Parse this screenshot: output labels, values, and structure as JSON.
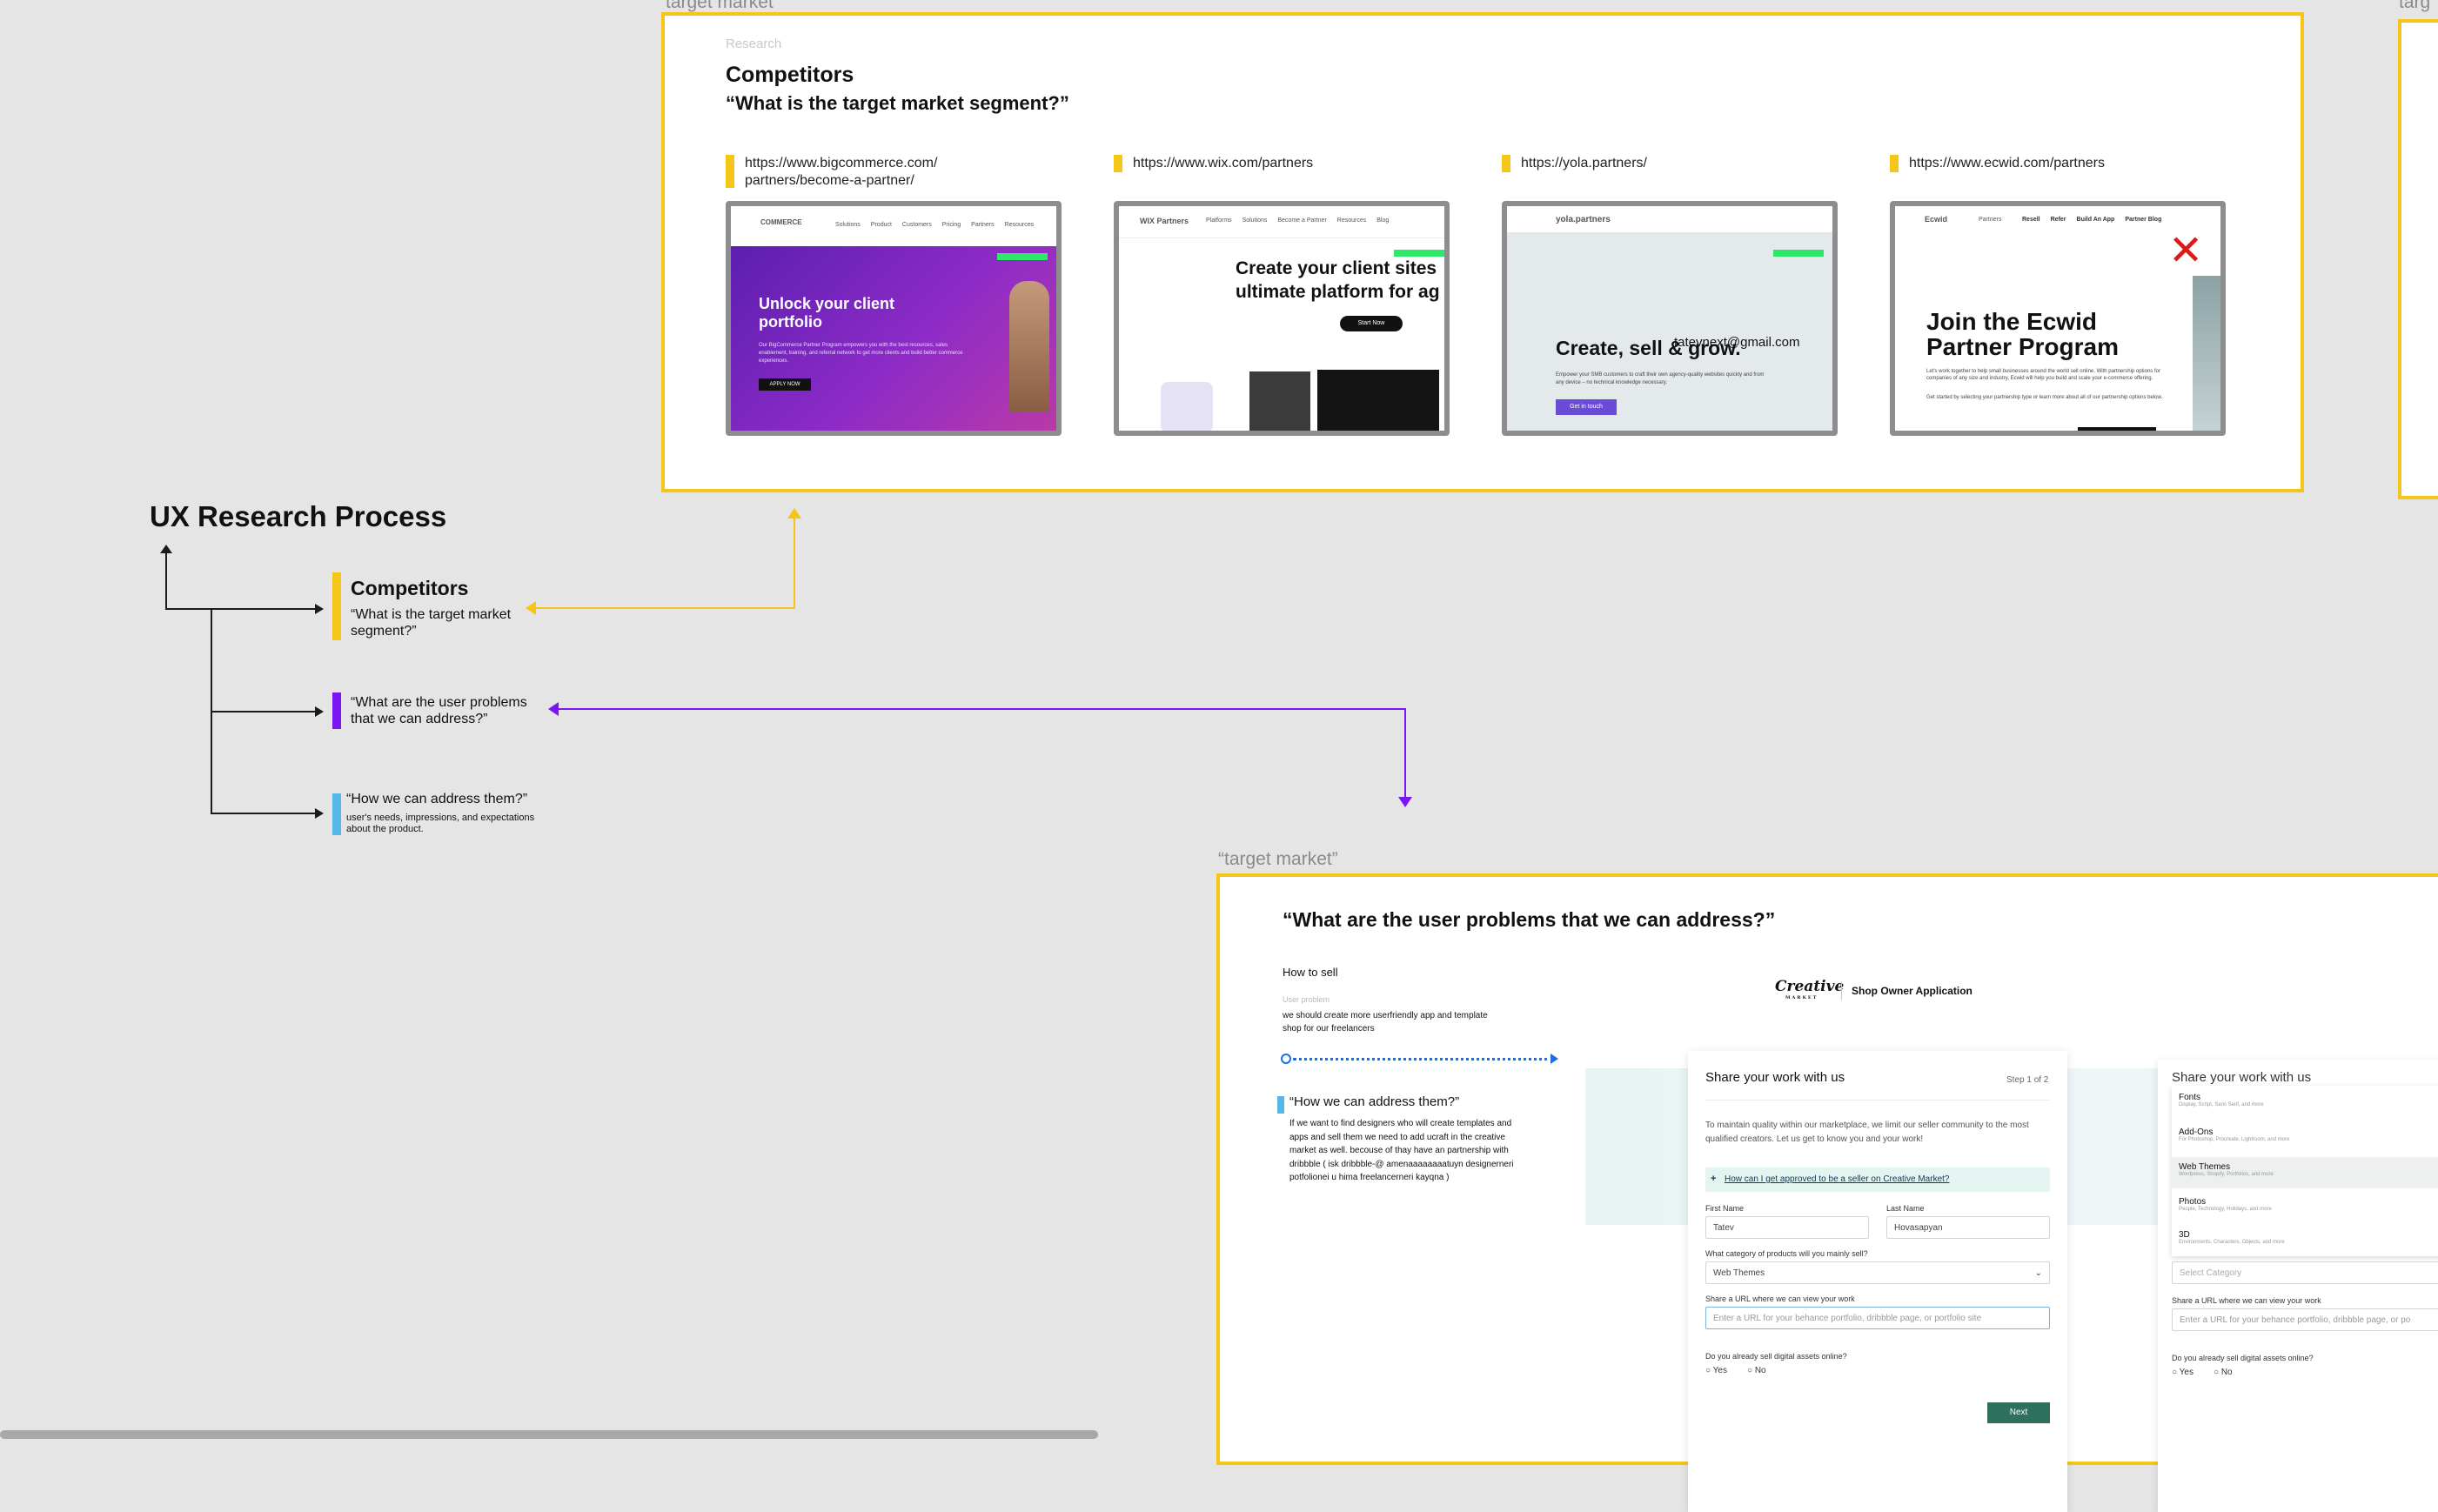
{
  "colors": {
    "accent_yellow": "#f5c518",
    "accent_purple": "#7a16f2",
    "accent_blue": "#54b8e8",
    "canvas": "#e5e5e5"
  },
  "top_frame": {
    "partial_label": "target market",
    "section": "Research",
    "title": "Competitors",
    "subtitle": "“What is the target market segment?”",
    "competitors": [
      {
        "url_line1": "https://www.bigcommerce.com/",
        "url_line2": "partners/become-a-partner/",
        "brand": "COMMERCE",
        "nav": [
          "Solutions",
          "Product",
          "Customers",
          "Pricing",
          "Partners",
          "Resources"
        ],
        "headline_1": "Unlock your client",
        "headline_2": "portfolio",
        "body": "Our BigCommerce Partner Program empowers you with the best resources, sales enablement, training, and referral network to get more clients and build better commerce experiences.",
        "cta": "APPLY NOW"
      },
      {
        "url_line1": "https://www.wix.com/partners",
        "brand": "WIX Partners",
        "nav": [
          "Platforms",
          "Solutions",
          "Become a Partner",
          "Resources",
          "Blog"
        ],
        "headline_1": "Create your client sites",
        "headline_2": "ultimate platform for ag",
        "cta": "Start Now"
      },
      {
        "url_line1": "https://yola.partners/",
        "brand": "yola.partners",
        "headline_1": "Create, sell & grow.",
        "overlay": "tatevnext@gmail.com",
        "body": "Empower your SMB customers to craft their own agency-quality websites quickly and from any device – no technical knowledge necessary.",
        "cta": "Get in touch"
      },
      {
        "url_line1": "https://www.ecwid.com/partners",
        "brand": "Ecwid",
        "brand_sub": "Partners",
        "nav": [
          "Resell",
          "Refer",
          "Build An App",
          "Partner Blog"
        ],
        "headline_1": "Join the Ecwid",
        "headline_2": "Partner Program",
        "body": "Let's work together to help small businesses around the world sell online. With partnership options for companies of any size and industry, Ecwid will help you build and scale your e-commerce offering.",
        "body2": "Get started by selecting your partnership type or learn more about all of our partnership options below.",
        "close_mark": "✕"
      }
    ]
  },
  "right_edge_label": "“targ",
  "process": {
    "title": "UX Research Process",
    "items": [
      {
        "title": "Competitors",
        "text": "“What is the target market segment?”"
      },
      {
        "text": "“What are the user problems that we can address?”"
      },
      {
        "text": "“How we can address them?”",
        "subtext": "user's needs, impressions, and expectations about the product."
      }
    ]
  },
  "bottom_frame": {
    "label": "“target market”",
    "title": "“What are the user problems that we can address?”",
    "how_to_sell": "How to sell",
    "user_problem_label": "User problem",
    "user_problem_text": "we should create more userfriendly app and template shop for our freelancers",
    "how_title": "“How we can address them?”",
    "how_text": "If we want to find designers who will create templates and apps and sell them we need to add ucraft in the creative market as well. becouse of thay have an partnership with dribbble ( isk dribbble-@ amenaaaaaaaatuyn designerneri potfolionei u hima freelancerneri kayqna )",
    "app": {
      "logo": "Creative",
      "logo_sub": "MARKET",
      "header": "Shop Owner Application",
      "card_title": "Share your work with us",
      "step": "Step 1 of 2",
      "intro": "To maintain quality within our marketplace, we limit our seller community to the most qualified creators. Let us get to know you and your work!",
      "faq": "How can I get approved to be a seller on Creative Market?",
      "first_name_label": "First Name",
      "first_name": "Tatev",
      "last_name_label": "Last Name",
      "last_name": "Hovasapyan",
      "category_label": "What category of products will you mainly sell?",
      "category": "Web Themes",
      "url_label": "Share a URL where we can view your work",
      "url_placeholder": "Enter a URL for your behance portfolio, dribbble page, or portfolio site",
      "digital_label": "Do you already sell digital assets online?",
      "yes": "Yes",
      "no": "No",
      "next": "Next"
    },
    "dropdown": {
      "card_title": "Share your work with us",
      "items": [
        {
          "name": "Fonts",
          "desc": "Display, Script, Sans Serif, and more"
        },
        {
          "name": "Add-Ons",
          "desc": "For Photoshop, Procreate, Lightroom, and more"
        },
        {
          "name": "Web Themes",
          "desc": "Wordpress, Shopify, Portfolios, and more"
        },
        {
          "name": "Photos",
          "desc": "People, Technology, Holidays, and more"
        },
        {
          "name": "3D",
          "desc": "Environments, Characters, Objects, and more"
        }
      ],
      "select_placeholder": "Select Category",
      "url_label": "Share a URL where we can view your work",
      "url_placeholder": "Enter a URL for your behance portfolio, dribbble page, or po",
      "digital_label": "Do you already sell digital assets online?",
      "yes": "Yes",
      "no": "No"
    }
  }
}
